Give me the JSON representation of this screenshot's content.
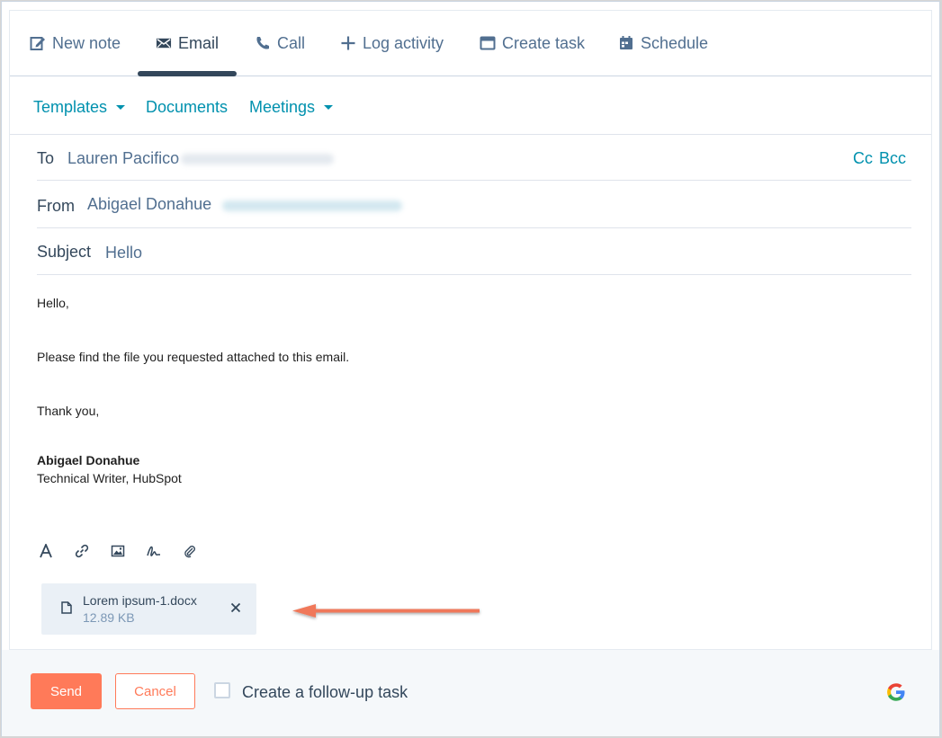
{
  "tabs": [
    {
      "label": "New note",
      "icon": "edit-icon"
    },
    {
      "label": "Email",
      "icon": "envelope-icon"
    },
    {
      "label": "Call",
      "icon": "phone-icon"
    },
    {
      "label": "Log activity",
      "icon": "plus-icon"
    },
    {
      "label": "Create task",
      "icon": "task-window-icon"
    },
    {
      "label": "Schedule",
      "icon": "calendar-icon"
    }
  ],
  "active_tab": "Email",
  "subbar": {
    "templates": "Templates",
    "documents": "Documents",
    "meetings": "Meetings"
  },
  "email": {
    "to_label": "To",
    "to_name": "Lauren Pacifico",
    "cc": "Cc",
    "bcc": "Bcc",
    "from_label": "From",
    "from_name": "Abigael Donahue",
    "subject_label": "Subject",
    "subject_value": "Hello",
    "body": {
      "greeting": "Hello,",
      "line1": "Please find the file you requested attached to this email.",
      "closing": "Thank you,",
      "signature_name": "Abigael Donahue",
      "signature_title": "Technical Writer, HubSpot"
    }
  },
  "toolbar_icons": [
    "text-format-icon",
    "link-icon",
    "image-icon",
    "signature-icon",
    "attachment-icon"
  ],
  "attachment": {
    "name": "Lorem ipsum-1.docx",
    "size": "12.89 KB"
  },
  "footer": {
    "send": "Send",
    "cancel": "Cancel",
    "follow_up": "Create a follow-up task"
  },
  "colors": {
    "accent": "#0091ae",
    "send": "#ff7a59",
    "text": "#33475b",
    "arrow": "#f0785a"
  }
}
